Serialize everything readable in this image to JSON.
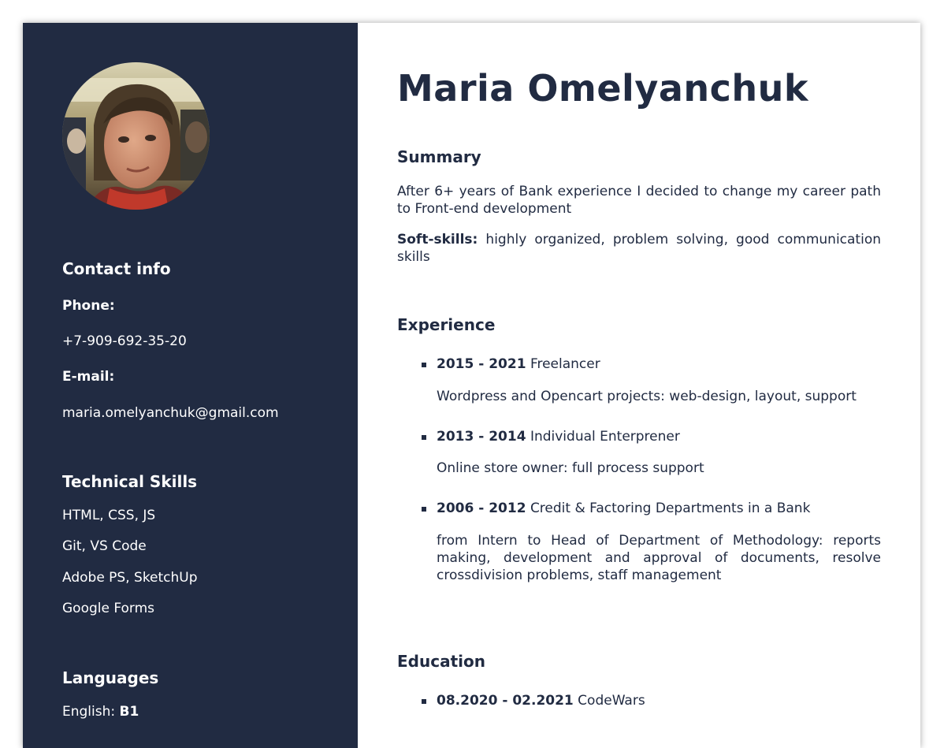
{
  "name": "Maria Omelyanchuk",
  "colors": {
    "sidebar_bg": "#212b42",
    "text_dark": "#212b42",
    "text_light": "#ffffff"
  },
  "sidebar": {
    "photo_alt": "profile photo",
    "contact": {
      "heading": "Contact info",
      "phone_label": "Phone:",
      "phone": "+7-909-692-35-20",
      "email_label": "E-mail:",
      "email": "maria.omelyanchuk@gmail.com"
    },
    "skills": {
      "heading": "Technical Skills",
      "items": [
        "HTML, CSS, JS",
        "Git, VS Code",
        "Adobe PS, SketchUp",
        "Google Forms"
      ]
    },
    "languages": {
      "heading": "Languages",
      "english_label": "English:",
      "english_level": "B1"
    }
  },
  "summary": {
    "heading": "Summary",
    "text": "After 6+ years of Bank experience I decided to change my career path to Front-end development",
    "soft_label": "Soft-skills:",
    "soft_text": "highly organized, problem solving, good communication skills"
  },
  "experience": {
    "heading": "Experience",
    "items": [
      {
        "period": "2015 - 2021",
        "title": "Freelancer",
        "description": "Wordpress and Opencart projects: web-design, layout, support"
      },
      {
        "period": "2013 - 2014",
        "title": "Individual Enterprener",
        "description": "Online store owner: full process support"
      },
      {
        "period": "2006 - 2012",
        "title": "Credit & Factoring Departments in a Bank",
        "description": "from Intern to Head of Department of Methodology: reports making, development and approval of documents, resolve crossdivision problems, staff management"
      }
    ]
  },
  "education": {
    "heading": "Education",
    "items": [
      {
        "period": "08.2020 - 02.2021",
        "title": "CodeWars"
      }
    ]
  }
}
